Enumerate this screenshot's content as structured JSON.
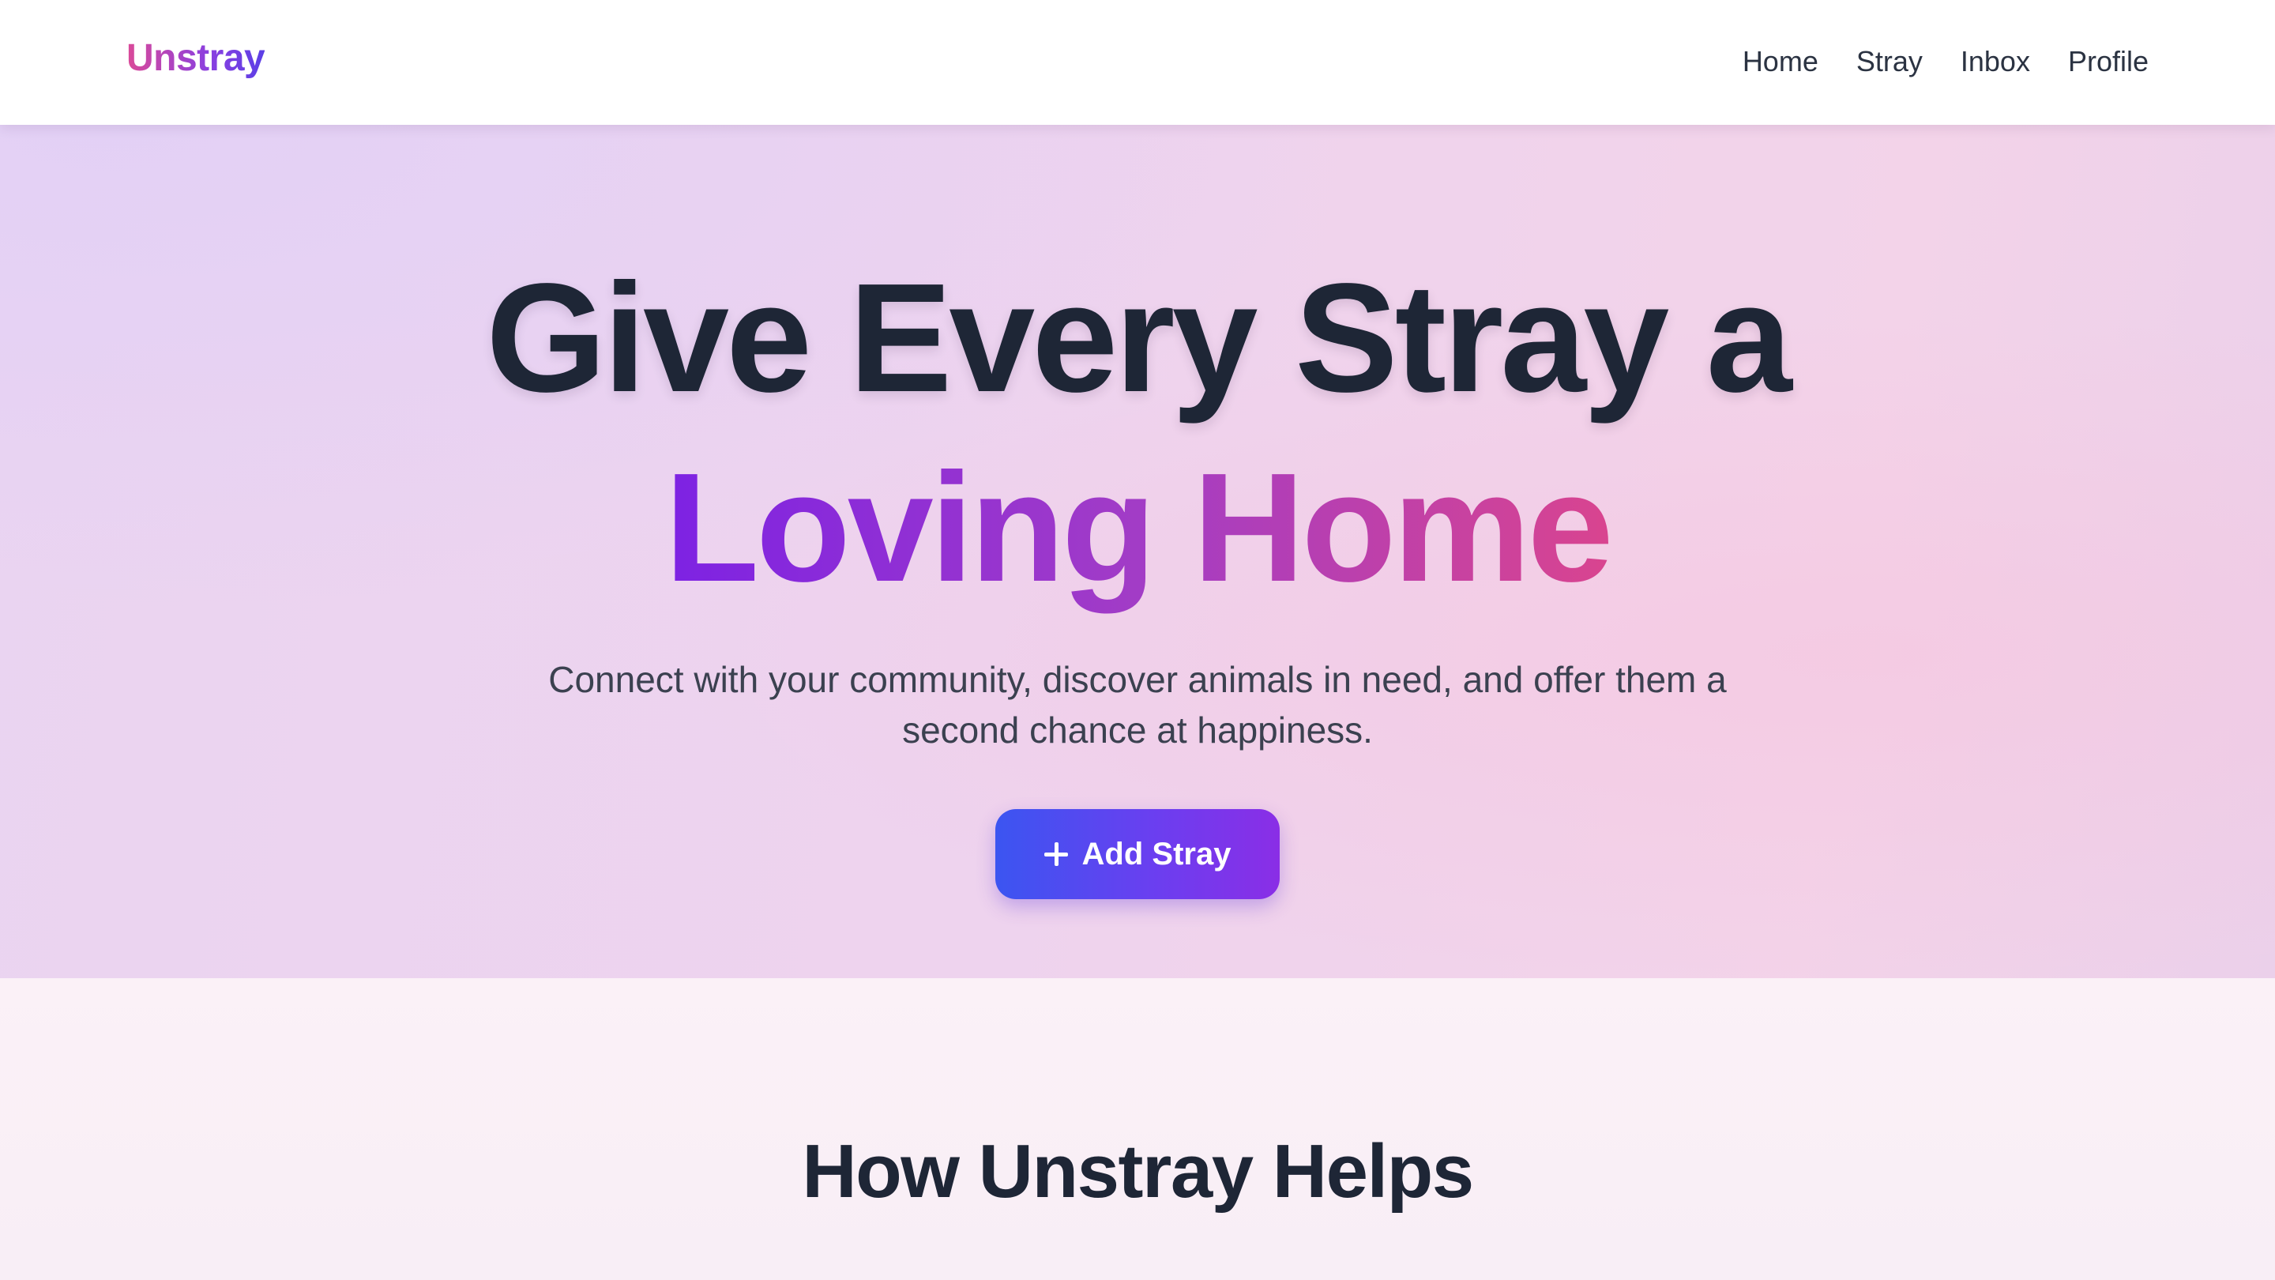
{
  "navbar": {
    "brand": "Unstray",
    "links": [
      "Home",
      "Stray",
      "Inbox",
      "Profile"
    ]
  },
  "hero": {
    "headline_line1": "Give Every Stray a",
    "headline_line2": "Loving Home",
    "subtitle": "Connect with your community, discover animals in need, and offer them a second chance at happiness.",
    "cta_label": "Add Stray",
    "cta_icon": "plus-icon"
  },
  "section": {
    "title": "How Unstray Helps"
  },
  "colors": {
    "brand_gradient_start": "#db4a98",
    "brand_gradient_end": "#5b3fe6",
    "headline": "#1e2636",
    "accent_gradient_start": "#7d22e3",
    "accent_gradient_end": "#d9448f",
    "cta_gradient_start": "#3b55f1",
    "cta_gradient_end": "#8a2ee6"
  }
}
